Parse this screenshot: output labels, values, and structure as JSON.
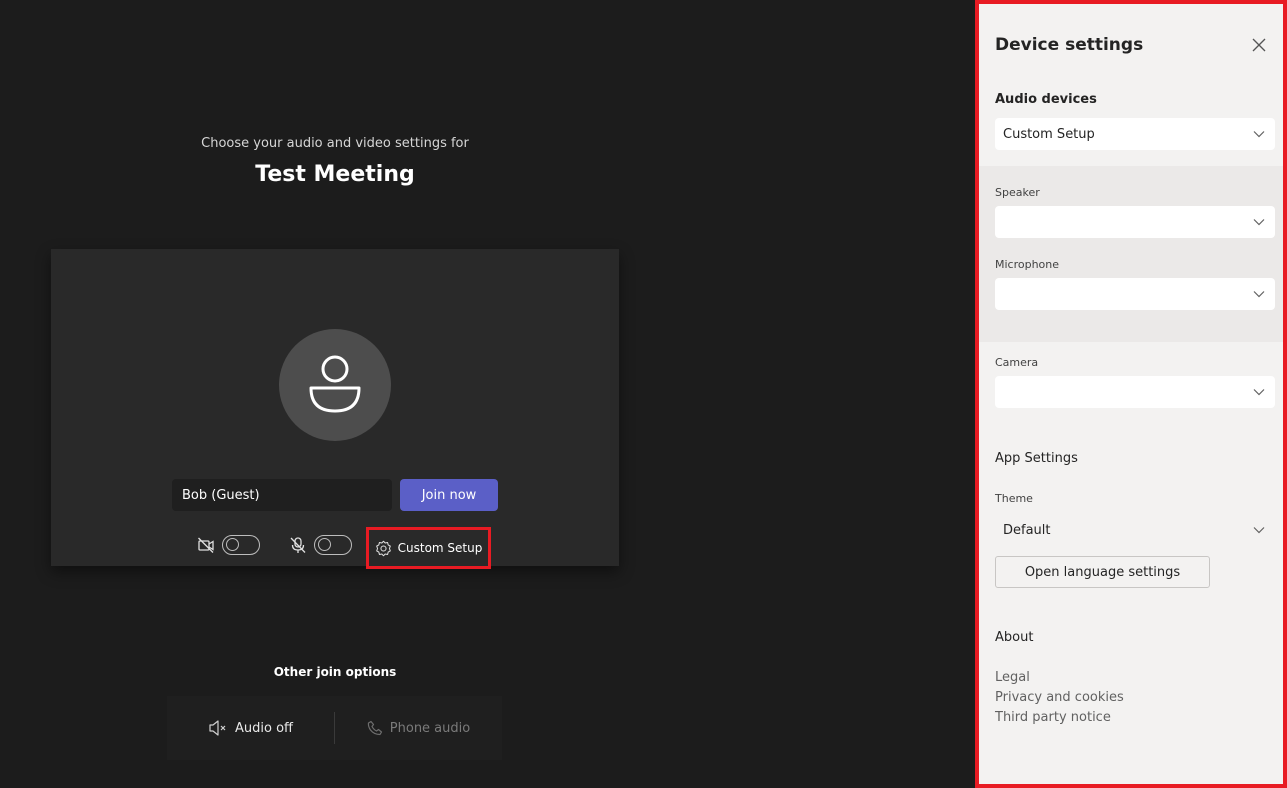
{
  "prejoin": {
    "subtitle": "Choose your audio and video settings for",
    "meeting_title": "Test Meeting",
    "name_value": "Bob (Guest)",
    "join_button": "Join now",
    "camera_toggle": {
      "state": "off",
      "icon": "camera-off-icon"
    },
    "mic_toggle": {
      "state": "off",
      "icon": "mic-off-icon"
    },
    "custom_setup_label": "Custom Setup",
    "highlight_color": "#e81b23",
    "accent_color": "#5b5fc7"
  },
  "other_join": {
    "title": "Other join options",
    "options": [
      {
        "label": "Audio off",
        "icon": "speaker-mute-icon",
        "enabled": true
      },
      {
        "label": "Phone audio",
        "icon": "phone-icon",
        "enabled": false
      }
    ]
  },
  "device_settings": {
    "title": "Device settings",
    "audio_devices_label": "Audio devices",
    "audio_devices_value": "Custom Setup",
    "speaker_label": "Speaker",
    "speaker_value": "",
    "microphone_label": "Microphone",
    "microphone_value": "",
    "camera_label": "Camera",
    "camera_value": "",
    "app_settings_label": "App Settings",
    "theme_label": "Theme",
    "theme_value": "Default",
    "language_button": "Open language settings",
    "about_label": "About",
    "about_links": [
      "Legal",
      "Privacy and cookies",
      "Third party notice"
    ]
  }
}
